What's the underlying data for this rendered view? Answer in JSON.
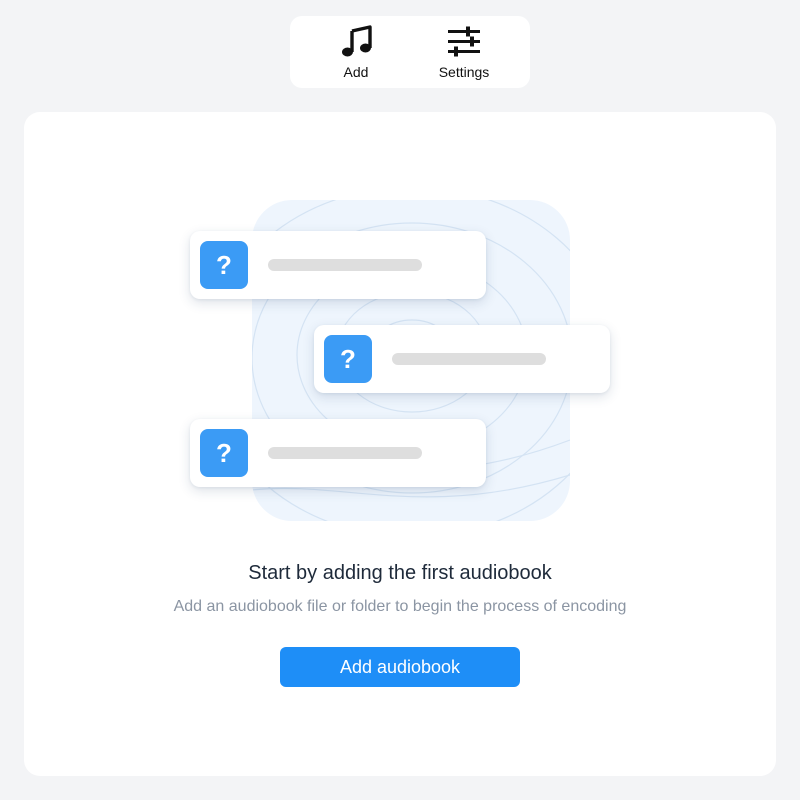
{
  "toolbar": {
    "add": {
      "label": "Add",
      "icon": "music-note-icon"
    },
    "settings": {
      "label": "Settings",
      "icon": "sliders-icon"
    }
  },
  "empty_state": {
    "illustration": {
      "placeholder_items": [
        {
          "badge": "?"
        },
        {
          "badge": "?"
        },
        {
          "badge": "?"
        }
      ]
    },
    "title": "Start by adding the first audiobook",
    "description": "Add an audiobook file or folder to begin the process of encoding",
    "button_label": "Add audiobook"
  },
  "colors": {
    "page_bg": "#f3f4f6",
    "accent": "#1e8ef7",
    "badge": "#3b9bf5",
    "illustration_bg": "#eef5fd"
  }
}
